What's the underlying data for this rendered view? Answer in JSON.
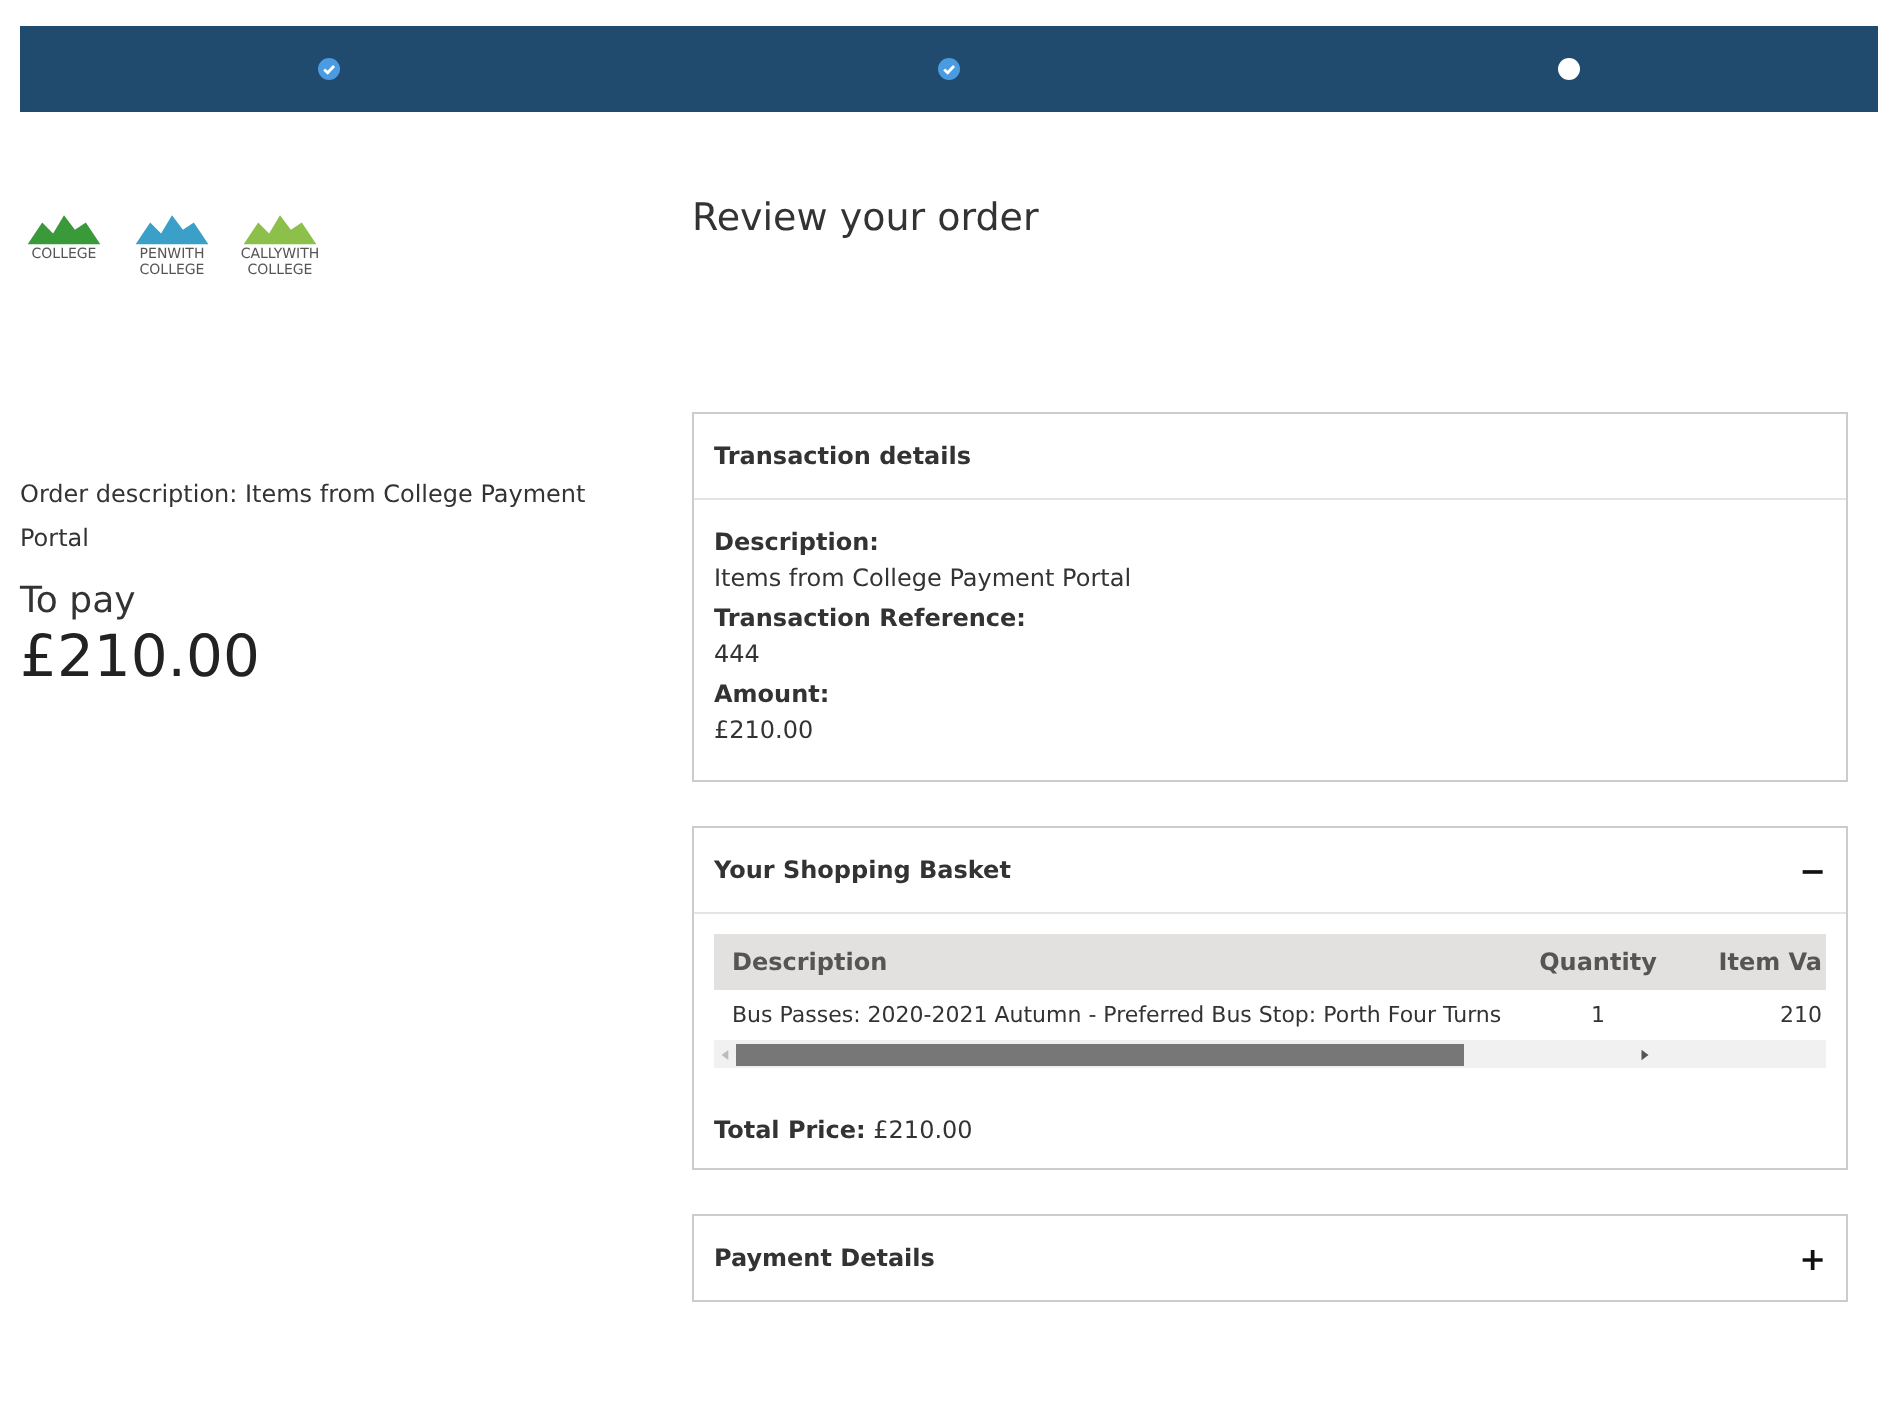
{
  "steps": [
    {
      "completed": true
    },
    {
      "completed": true
    },
    {
      "completed": false
    }
  ],
  "logos": [
    {
      "lines": [
        "COLLEGE"
      ],
      "color": "#3a9a3a"
    },
    {
      "lines": [
        "PENWITH",
        "COLLEGE"
      ],
      "color": "#3aa0c8"
    },
    {
      "lines": [
        "CALLYWITH",
        "COLLEGE"
      ],
      "color": "#8cc04a"
    }
  ],
  "order_description": "Order description: Items from College Payment Portal",
  "to_pay_label": "To pay",
  "to_pay_amount": "£210.00",
  "page_title": "Review your order",
  "panels": [
    {
      "kind": "details",
      "title": "Transaction details",
      "expanded": true,
      "fields": [
        {
          "label": "Description:",
          "value": "Items from College Payment Portal"
        },
        {
          "label": "Transaction Reference:",
          "value": "444"
        },
        {
          "label": "Amount:",
          "value": "£210.00"
        }
      ]
    },
    {
      "kind": "basket",
      "title": "Your Shopping Basket",
      "toggle": "−",
      "expanded": true,
      "table": {
        "columns": [
          "Description",
          "Quantity",
          "Item Va"
        ],
        "rows": [
          [
            "Bus Passes: 2020-2021 Autumn - Preferred Bus Stop: Porth Four Turns",
            "1",
            "210"
          ]
        ]
      },
      "total": "**Total Price:** £210.00"
    },
    {
      "title": "Payment Details",
      "toggle": "+",
      "expanded": false
    }
  ]
}
